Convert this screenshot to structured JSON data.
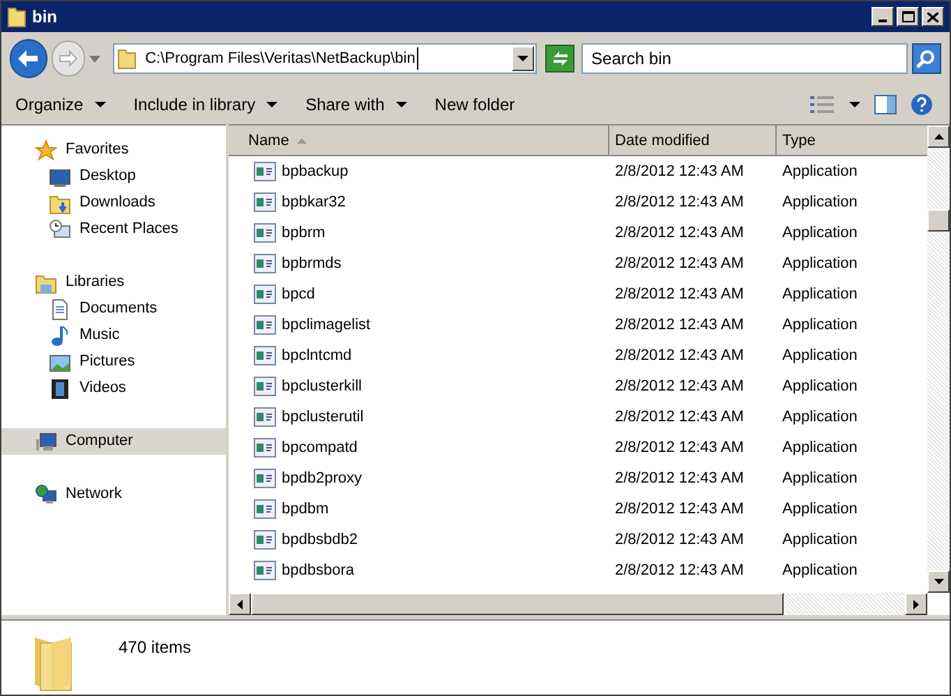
{
  "window": {
    "title": "bin"
  },
  "address": {
    "value": "C:\\Program Files\\Veritas\\NetBackup\\bin"
  },
  "search": {
    "placeholder": "Search bin"
  },
  "toolbar": [
    {
      "label": "Organize",
      "dropdown": true
    },
    {
      "label": "Include in library",
      "dropdown": true
    },
    {
      "label": "Share with",
      "dropdown": true
    },
    {
      "label": "New folder",
      "dropdown": false
    }
  ],
  "sidebar": {
    "items": [
      {
        "label": "Favorites",
        "kind": "star",
        "selected": false,
        "children": [
          {
            "label": "Desktop",
            "kind": "desktop",
            "selected": false
          },
          {
            "label": "Downloads",
            "kind": "downloads",
            "selected": false
          },
          {
            "label": "Recent Places",
            "kind": "recent",
            "selected": false
          }
        ]
      },
      {
        "label": "Libraries",
        "kind": "library",
        "selected": false,
        "children": [
          {
            "label": "Documents",
            "kind": "document",
            "selected": false
          },
          {
            "label": "Music",
            "kind": "music",
            "selected": false
          },
          {
            "label": "Pictures",
            "kind": "pictures",
            "selected": false
          },
          {
            "label": "Videos",
            "kind": "videos",
            "selected": false
          }
        ]
      },
      {
        "label": "Computer",
        "kind": "computer",
        "selected": true
      },
      {
        "label": "Network",
        "kind": "network",
        "selected": false
      }
    ]
  },
  "table": {
    "columns": [
      {
        "label": "Name",
        "sorted": true
      },
      {
        "label": "Date modified",
        "sorted": false
      },
      {
        "label": "Type",
        "sorted": false
      }
    ],
    "rows": [
      [
        "bpbackup",
        "2/8/2012 12:43 AM",
        "Application"
      ],
      [
        "bpbkar32",
        "2/8/2012 12:43 AM",
        "Application"
      ],
      [
        "bpbrm",
        "2/8/2012 12:43 AM",
        "Application"
      ],
      [
        "bpbrmds",
        "2/8/2012 12:43 AM",
        "Application"
      ],
      [
        "bpcd",
        "2/8/2012 12:43 AM",
        "Application"
      ],
      [
        "bpclimagelist",
        "2/8/2012 12:43 AM",
        "Application"
      ],
      [
        "bpclntcmd",
        "2/8/2012 12:43 AM",
        "Application"
      ],
      [
        "bpclusterkill",
        "2/8/2012 12:43 AM",
        "Application"
      ],
      [
        "bpclusterutil",
        "2/8/2012 12:43 AM",
        "Application"
      ],
      [
        "bpcompatd",
        "2/8/2012 12:43 AM",
        "Application"
      ],
      [
        "bpdb2proxy",
        "2/8/2012 12:43 AM",
        "Application"
      ],
      [
        "bpdbm",
        "2/8/2012 12:43 AM",
        "Application"
      ],
      [
        "bpdbsbdb2",
        "2/8/2012 12:43 AM",
        "Application"
      ],
      [
        "bpdbsbora",
        "2/8/2012 12:43 AM",
        "Application"
      ]
    ]
  },
  "status_bar": {
    "text": "470 items"
  }
}
